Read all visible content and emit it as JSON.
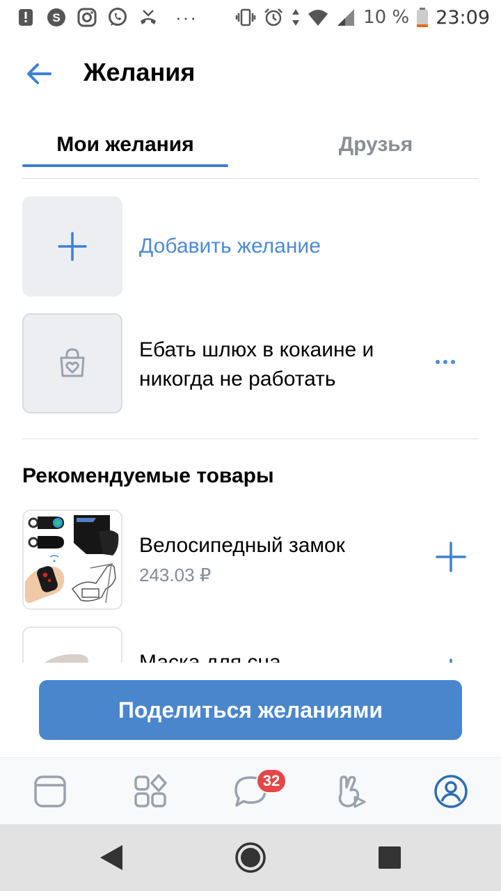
{
  "status_bar": {
    "icons": [
      "alert-icon",
      "skype-icon",
      "instagram-icon",
      "whatsapp-icon",
      "missed-call-icon",
      "more-notifications-icon",
      "vibrate-icon",
      "alarm-icon",
      "data-arrows-icon",
      "wifi-icon",
      "signal-icon",
      "battery-icon"
    ],
    "more": "···",
    "battery": "10 %",
    "time": "23:09"
  },
  "header": {
    "title": "Желания",
    "back_icon": "back-arrow-icon"
  },
  "tabs": [
    {
      "label": "Мои желания",
      "active": true
    },
    {
      "label": "Друзья",
      "active": false
    }
  ],
  "wishes": {
    "add_label": "Добавить желание",
    "items": [
      {
        "text": "Ебать шлюх в кокаине и никогда не работать",
        "icon": "shopping-bag-heart-icon",
        "menu_icon": "more-dots-icon"
      }
    ]
  },
  "recommended": {
    "title": "Рекомендуемые товары",
    "products": [
      {
        "name": "Велосипедный замок",
        "price": "243.03 ₽"
      },
      {
        "name": "Маска для сна",
        "price": ""
      }
    ]
  },
  "share_button": "Поделиться желаниями",
  "bottom_nav": {
    "items": [
      "news-icon",
      "services-icon",
      "messages-icon",
      "clips-icon",
      "profile-icon"
    ],
    "messages_badge": "32"
  },
  "system_nav": [
    "back-triangle-icon",
    "home-circle-icon",
    "recents-square-icon"
  ],
  "colors": {
    "accent": "#4986cc",
    "link": "#4b8bd5",
    "badge": "#e64646",
    "secondary_text": "#818c99"
  }
}
